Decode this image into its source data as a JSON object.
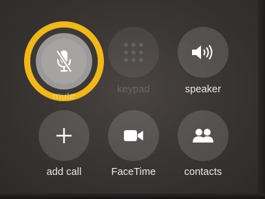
{
  "call_controls": {
    "row1": [
      {
        "label": "mute",
        "icon": "mic-off-icon",
        "state": "active",
        "enabled": true
      },
      {
        "label": "keypad",
        "icon": "keypad-icon",
        "state": "normal",
        "enabled": false
      },
      {
        "label": "speaker",
        "icon": "speaker-icon",
        "state": "normal",
        "enabled": true
      }
    ],
    "row2": [
      {
        "label": "add call",
        "icon": "plus-icon",
        "state": "normal",
        "enabled": true
      },
      {
        "label": "FaceTime",
        "icon": "video-camera-icon",
        "state": "normal",
        "enabled": true
      },
      {
        "label": "contacts",
        "icon": "contacts-icon",
        "state": "normal",
        "enabled": true
      }
    ]
  },
  "colors": {
    "highlight_ring": "#f1b817",
    "background": "#3a3634",
    "label_text": "#ececec"
  }
}
